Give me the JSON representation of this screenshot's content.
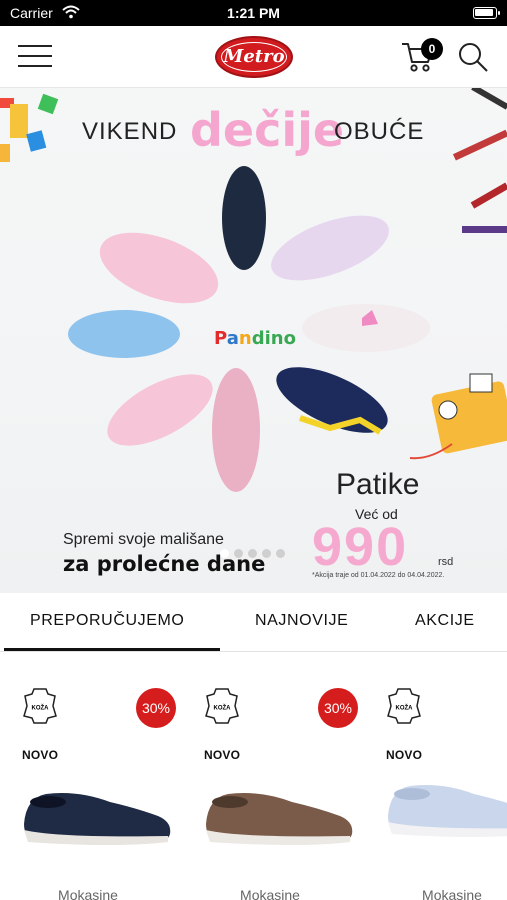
{
  "status_bar": {
    "carrier": "Carrier",
    "time": "1:21 PM"
  },
  "header": {
    "logo_text": "Metro",
    "cart_count": "0"
  },
  "banner": {
    "title_left": "VIKEND",
    "title_mid": "dečije",
    "title_right": "OBUĆE",
    "brand": [
      "P",
      "a",
      "n",
      "dino"
    ],
    "product": "Patike",
    "from_label": "Već od",
    "price": "990",
    "currency": "rsd",
    "note": "*Akcija traje od 01.04.2022 do 04.04.2022.",
    "slogan_line1": "Spremi svoje mališane",
    "slogan_line2": "za prolećne dane",
    "slides": 5,
    "active_slide": 0
  },
  "tabs": [
    {
      "label": "PREPORUČUJEMO",
      "active": true
    },
    {
      "label": "NAJNOVIJE",
      "active": false
    },
    {
      "label": "AKCIJE",
      "active": false
    }
  ],
  "products": [
    {
      "badge": "KOŽA",
      "discount": "30%",
      "tag": "NOVO",
      "name": "Mokasine",
      "color": "#1f2a44"
    },
    {
      "badge": "KOŽA",
      "discount": "30%",
      "tag": "NOVO",
      "name": "Mokasine",
      "color": "#7a5a48"
    },
    {
      "badge": "KOŽA",
      "discount": "",
      "tag": "NOVO",
      "name": "Mokasine",
      "color": "#c9d6ec"
    }
  ],
  "colors": {
    "accent_red": "#d21b1f",
    "pink": "#f4a6cf"
  }
}
